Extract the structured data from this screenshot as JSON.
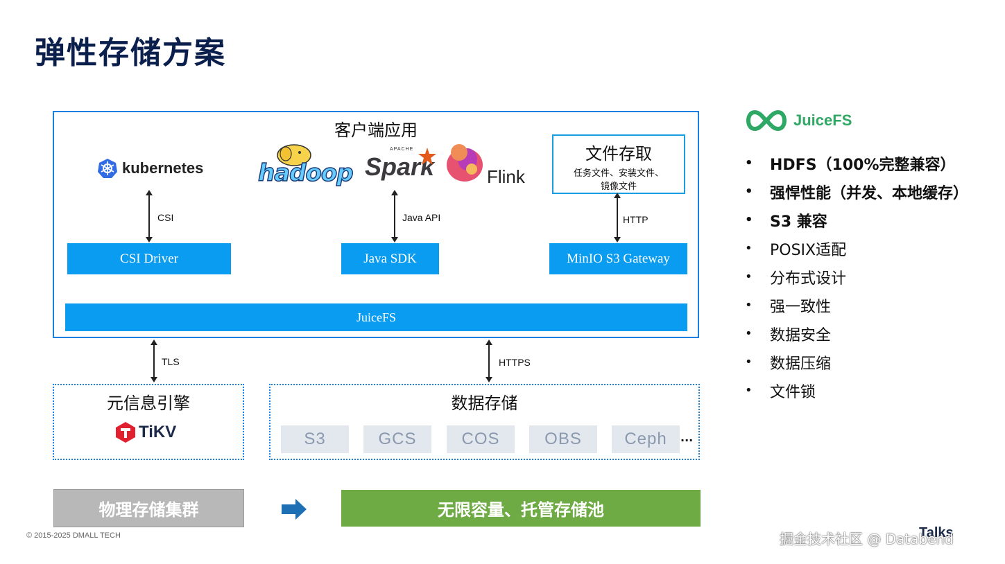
{
  "title": "弹性存储方案",
  "client": {
    "title": "客户端应用",
    "logos": {
      "kubernetes": "kubernetes",
      "hadoop": "hadoop",
      "spark": "Spark",
      "spark_apache": "APACHE",
      "flink": "Flink"
    },
    "file_access": {
      "title": "文件存取",
      "line1": "任务文件、安装文件、",
      "line2": "镜像文件"
    },
    "links": {
      "csi": "CSI",
      "java_api": "Java API",
      "http": "HTTP"
    },
    "drivers": {
      "csi_driver": "CSI Driver",
      "java_sdk": "Java SDK",
      "minio": "MinIO S3 Gateway"
    },
    "juicefs_bar": "JuiceFS"
  },
  "links": {
    "tls": "TLS",
    "https": "HTTPS"
  },
  "meta_engine": {
    "title": "元信息引擎",
    "logo": "TiKV"
  },
  "data_storage": {
    "title": "数据存储",
    "items": [
      "S3",
      "GCS",
      "COS",
      "OBS",
      "Ceph"
    ],
    "more": "..."
  },
  "bottom": {
    "left": "物理存储集群",
    "right": "无限容量、托管存储池"
  },
  "sidebar": {
    "logo": "JuiceFS",
    "features": [
      {
        "text": "HDFS（100%完整兼容）",
        "bold": true
      },
      {
        "text": "强悍性能（并发、本地缓存）",
        "bold": true
      },
      {
        "text": "S3 兼容",
        "bold": true
      },
      {
        "text": "POSIX适配",
        "bold": false
      },
      {
        "text": "分布式设计",
        "bold": false
      },
      {
        "text": "强一致性",
        "bold": false
      },
      {
        "text": "数据安全",
        "bold": false
      },
      {
        "text": "数据压缩",
        "bold": false
      },
      {
        "text": "文件锁",
        "bold": false
      }
    ]
  },
  "footer": {
    "copyright": "© 2015-2025 DMALL TECH",
    "watermark": "掘金技术社区 @ Databend",
    "talks": "Talks"
  },
  "colors": {
    "title": "#0b1f4d",
    "blue": "#0a9cf0",
    "border": "#1a7fe0",
    "green": "#6fab45",
    "grey": "#b8b8b8",
    "juicefs_green": "#2fa866"
  }
}
